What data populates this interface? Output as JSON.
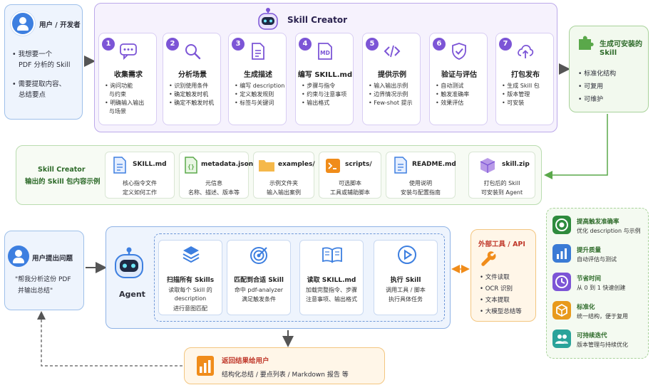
{
  "user": {
    "title": "用户 / 开发者",
    "bullets": [
      "• 我想要一个",
      "PDF 分析的 Skill",
      "• 需要提取内容、",
      "总结要点"
    ]
  },
  "creator": {
    "title": "Skill Creator",
    "steps": [
      {
        "num": "1",
        "title": "收集需求",
        "lines": [
          "• 询问功能",
          "与约束",
          "• 明确输入输出",
          "与场景"
        ]
      },
      {
        "num": "2",
        "title": "分析场景",
        "lines": [
          "• 识别使用条件",
          "• 确定触发时机",
          "• 确定不触发时机"
        ]
      },
      {
        "num": "3",
        "title": "生成描述",
        "lines": [
          "• 编写 description",
          "• 定义触发规则",
          "• 标签与关键词"
        ]
      },
      {
        "num": "4",
        "title": "编写 SKILL.md",
        "lines": [
          "• 步骤与指令",
          "• 约束与注意事项",
          "• 输出格式"
        ]
      },
      {
        "num": "5",
        "title": "提供示例",
        "lines": [
          "• 输入输出示例",
          "• 边界情况示例",
          "• Few-shot 提示"
        ]
      },
      {
        "num": "6",
        "title": "验证与评估",
        "lines": [
          "• 自动测试",
          "• 触发准确率",
          "• 效果评估"
        ]
      },
      {
        "num": "7",
        "title": "打包发布",
        "lines": [
          "• 生成 Skill 包",
          "• 版本管理",
          "• 可安装"
        ]
      }
    ]
  },
  "installable": {
    "title1": "生成可安装的",
    "title2": "Skill",
    "bullets": [
      "• 标准化结构",
      "• 可复用",
      "• 可维护"
    ]
  },
  "package": {
    "label1": "Skill Creator",
    "label2": "输出的 Skill 包内容示例",
    "cards": [
      {
        "title": "SKILL.md",
        "l1": "核心指令文件",
        "l2": "定义如何工作"
      },
      {
        "title": "metadata.json",
        "l1": "元信息",
        "l2": "名称、描述、版本等"
      },
      {
        "title": "examples/",
        "l1": "示例文件夹",
        "l2": "输入输出案例"
      },
      {
        "title": "scripts/",
        "l1": "可选脚本",
        "l2": "工具或辅助脚本"
      },
      {
        "title": "README.md",
        "l1": "使用说明",
        "l2": "安装与配置指南"
      },
      {
        "title": "skill.zip",
        "l1": "打包后的 Skill",
        "l2": "可安装到 Agent"
      }
    ]
  },
  "question": {
    "title": "用户提出问题",
    "quote1": "\"帮我分析这份 PDF",
    "quote2": "并输出总结\""
  },
  "agent": {
    "label": "Agent",
    "steps": [
      {
        "title": "扫描所有 Skills",
        "lines": [
          "读取每个 Skill 的",
          "description",
          "进行意图匹配"
        ]
      },
      {
        "title": "匹配到合适 Skill",
        "lines": [
          "命中 pdf-analyzer",
          "满足触发条件"
        ]
      },
      {
        "title": "读取 SKILL.md",
        "lines": [
          "加载完整指令、步骤",
          "注意事项、输出格式"
        ]
      },
      {
        "title": "执行 Skill",
        "lines": [
          "调用工具 / 脚本",
          "执行具体任务"
        ]
      }
    ]
  },
  "tools": {
    "title": "外部工具 / API",
    "bullets": [
      "• 文件读取",
      "• OCR 识别",
      "• 文本提取",
      "• 大模型总结等"
    ]
  },
  "result": {
    "title": "返回结果给用户",
    "desc": "结构化总结 / 要点列表 / Markdown 报告 等"
  },
  "benefits": [
    {
      "title": "提高触发准确率",
      "desc": "优化 description 与示例",
      "color": "#2e8b3d"
    },
    {
      "title": "提升质量",
      "desc": "自动评估与测试",
      "color": "#3a7bd5"
    },
    {
      "title": "节省时间",
      "desc": "从 0 到 1 快速创建",
      "color": "#7c55d6"
    },
    {
      "title": "标准化",
      "desc": "统一结构，便于复用",
      "color": "#e89a1c"
    },
    {
      "title": "可持续迭代",
      "desc": "版本管理与持续优化",
      "color": "#2aa39a"
    }
  ],
  "colors": {
    "purple": "#7c55d6",
    "blue": "#3d7fe0",
    "green": "#5aa84a",
    "orange": "#f08c1a"
  }
}
